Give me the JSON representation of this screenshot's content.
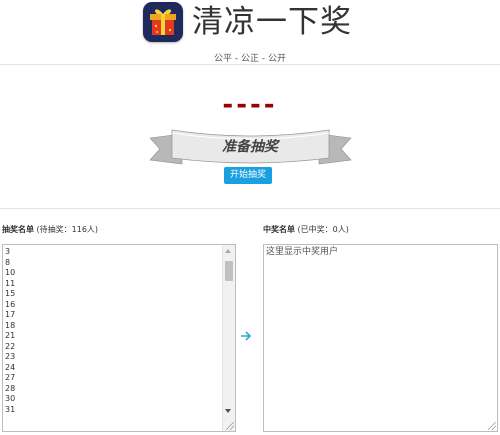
{
  "header": {
    "title": "清凉一下奖",
    "subtitle": "公平 - 公正 - 公开",
    "logo_icon": "gift-box-icon"
  },
  "draw": {
    "result_placeholder": "----",
    "banner_text": "准备抽奖",
    "start_button": "开始抽奖"
  },
  "pending": {
    "title": "抽奖名单",
    "status": "(待抽奖：116人)",
    "entries": [
      "3",
      "8",
      "10",
      "11",
      "15",
      "16",
      "17",
      "18",
      "21",
      "22",
      "23",
      "24",
      "27",
      "28",
      "30",
      "31"
    ]
  },
  "winners": {
    "title": "中奖名单",
    "status": "(已中奖：0人)",
    "placeholder": "这里显示中奖用户"
  },
  "colors": {
    "accent": "#1a9fe0",
    "result": "#990000",
    "arrow": "#3aa0d8"
  }
}
